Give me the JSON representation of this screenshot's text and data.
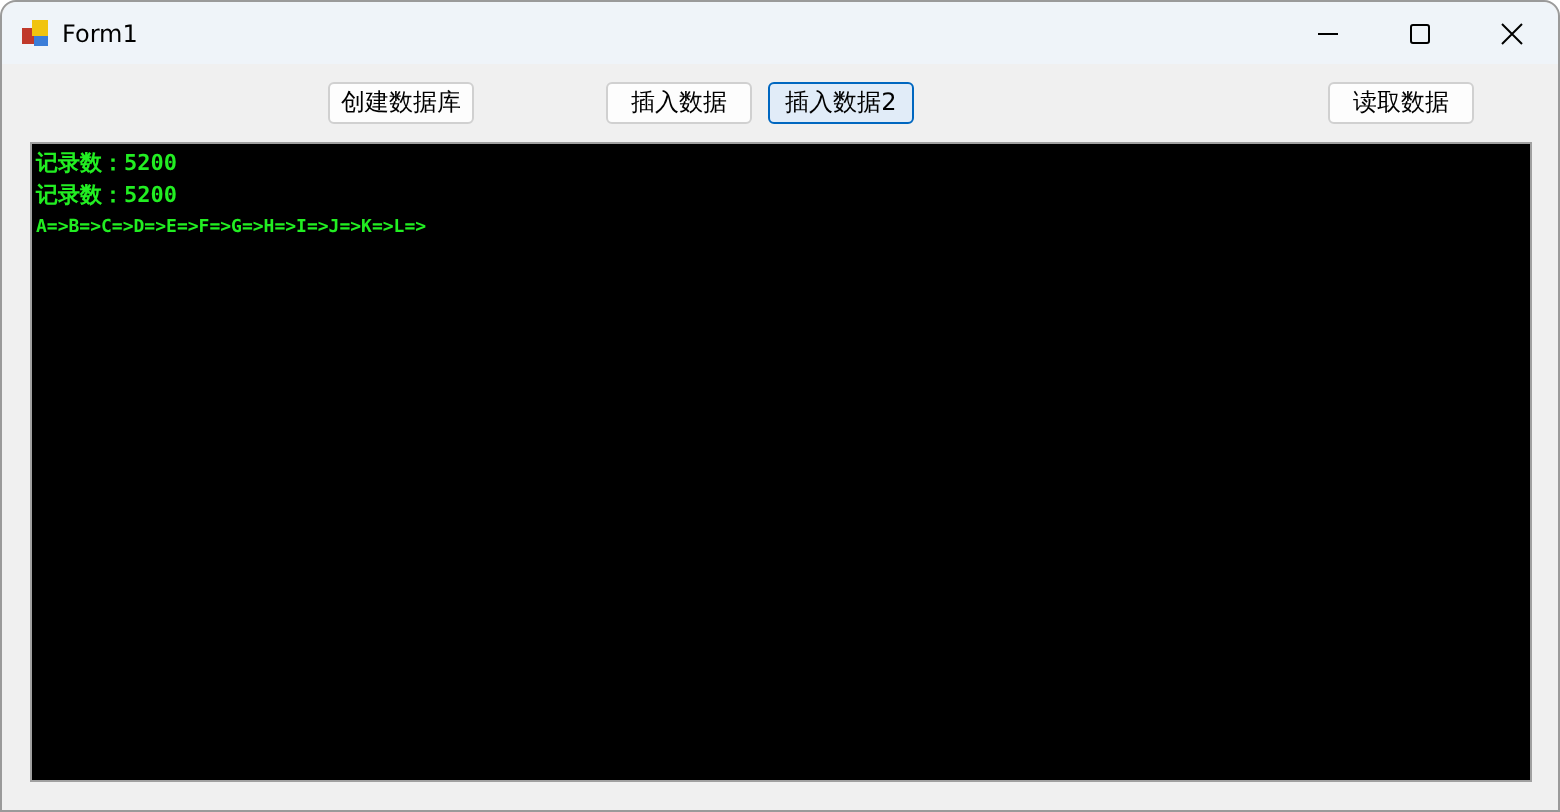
{
  "window": {
    "title": "Form1"
  },
  "buttons": [
    {
      "label": "创建数据库",
      "selected": false
    },
    {
      "label": "插入数据",
      "selected": false
    },
    {
      "label": "插入数据2",
      "selected": true
    },
    {
      "label": "读取数据",
      "selected": false
    }
  ],
  "console": {
    "lines": [
      "记录数：5200",
      "记录数：5200",
      "A=>B=>C=>D=>E=>F=>G=>H=>I=>J=>K=>L=>"
    ]
  }
}
